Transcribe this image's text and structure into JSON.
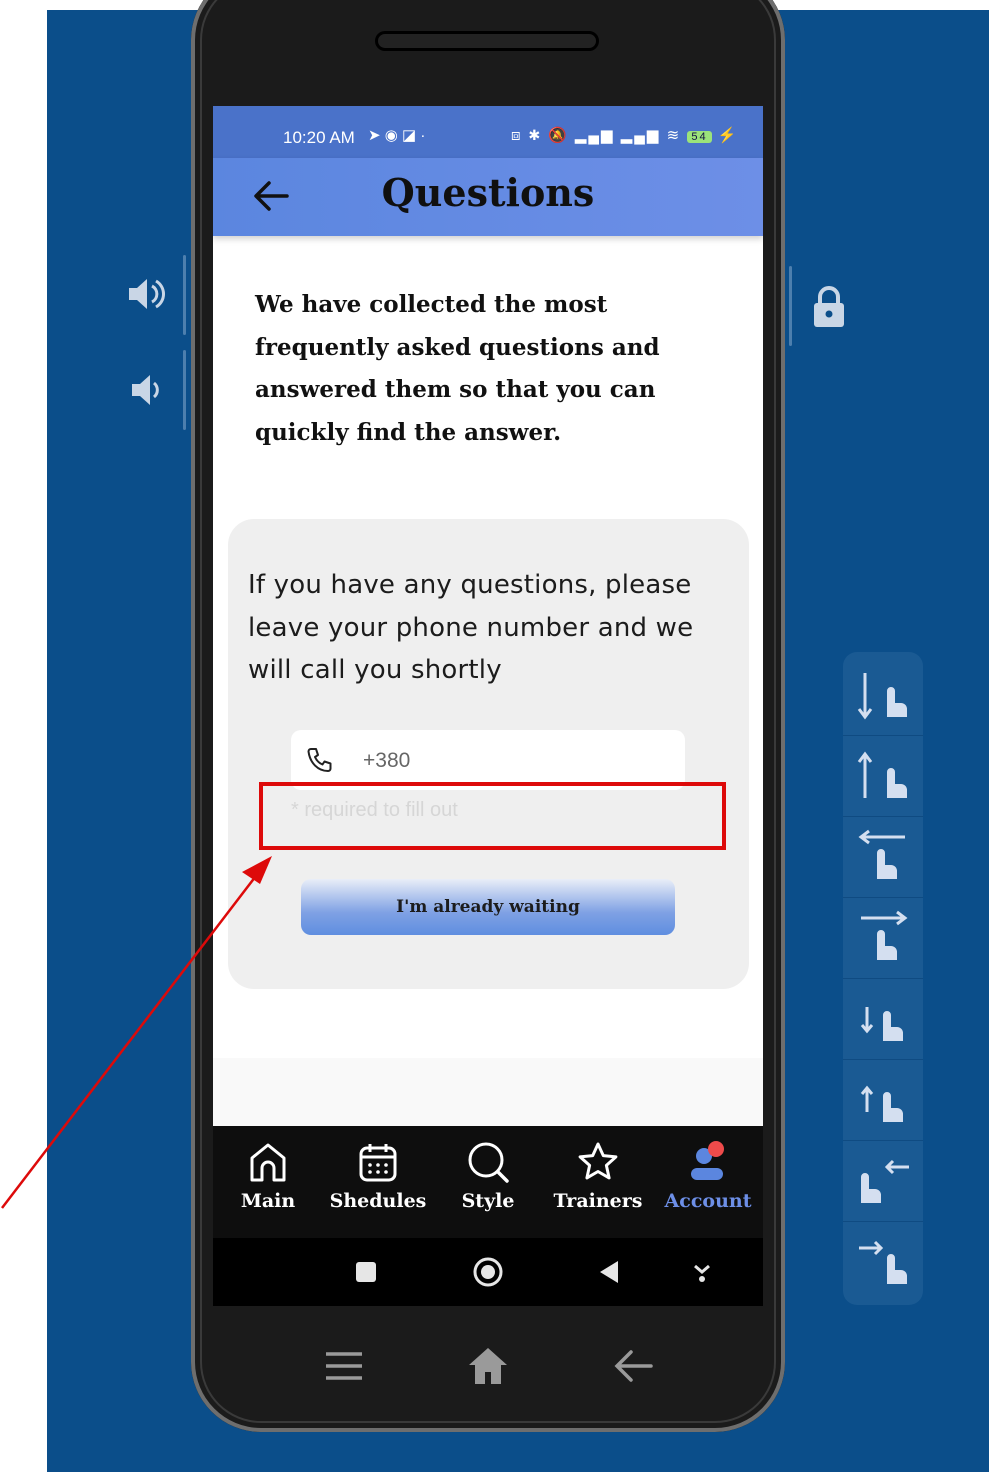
{
  "status": {
    "time": "10:20 AM",
    "battery": "54"
  },
  "appbar": {
    "title": "Questions"
  },
  "intro": {
    "text": "We have collected the most frequently asked questions and answered them so that you can quickly find the answer."
  },
  "contact": {
    "message": "If you have any questions, please leave your phone number and we will call you shortly",
    "phone_placeholder": "+380",
    "hint": "* required to fill out",
    "submit_label": "I'm already waiting"
  },
  "bottom_nav": {
    "items": [
      {
        "label": "Main",
        "icon": "home-icon"
      },
      {
        "label": "Shedules",
        "icon": "calendar-icon"
      },
      {
        "label": "Style",
        "icon": "search-icon"
      },
      {
        "label": "Trainers",
        "icon": "star-icon"
      },
      {
        "label": "Account",
        "icon": "account-icon",
        "active": true
      }
    ]
  },
  "colors": {
    "accent": "#5b86df",
    "active_nav": "#6d8fe7",
    "annotation": "#dd0a0a",
    "background": "#0b4e8a"
  }
}
